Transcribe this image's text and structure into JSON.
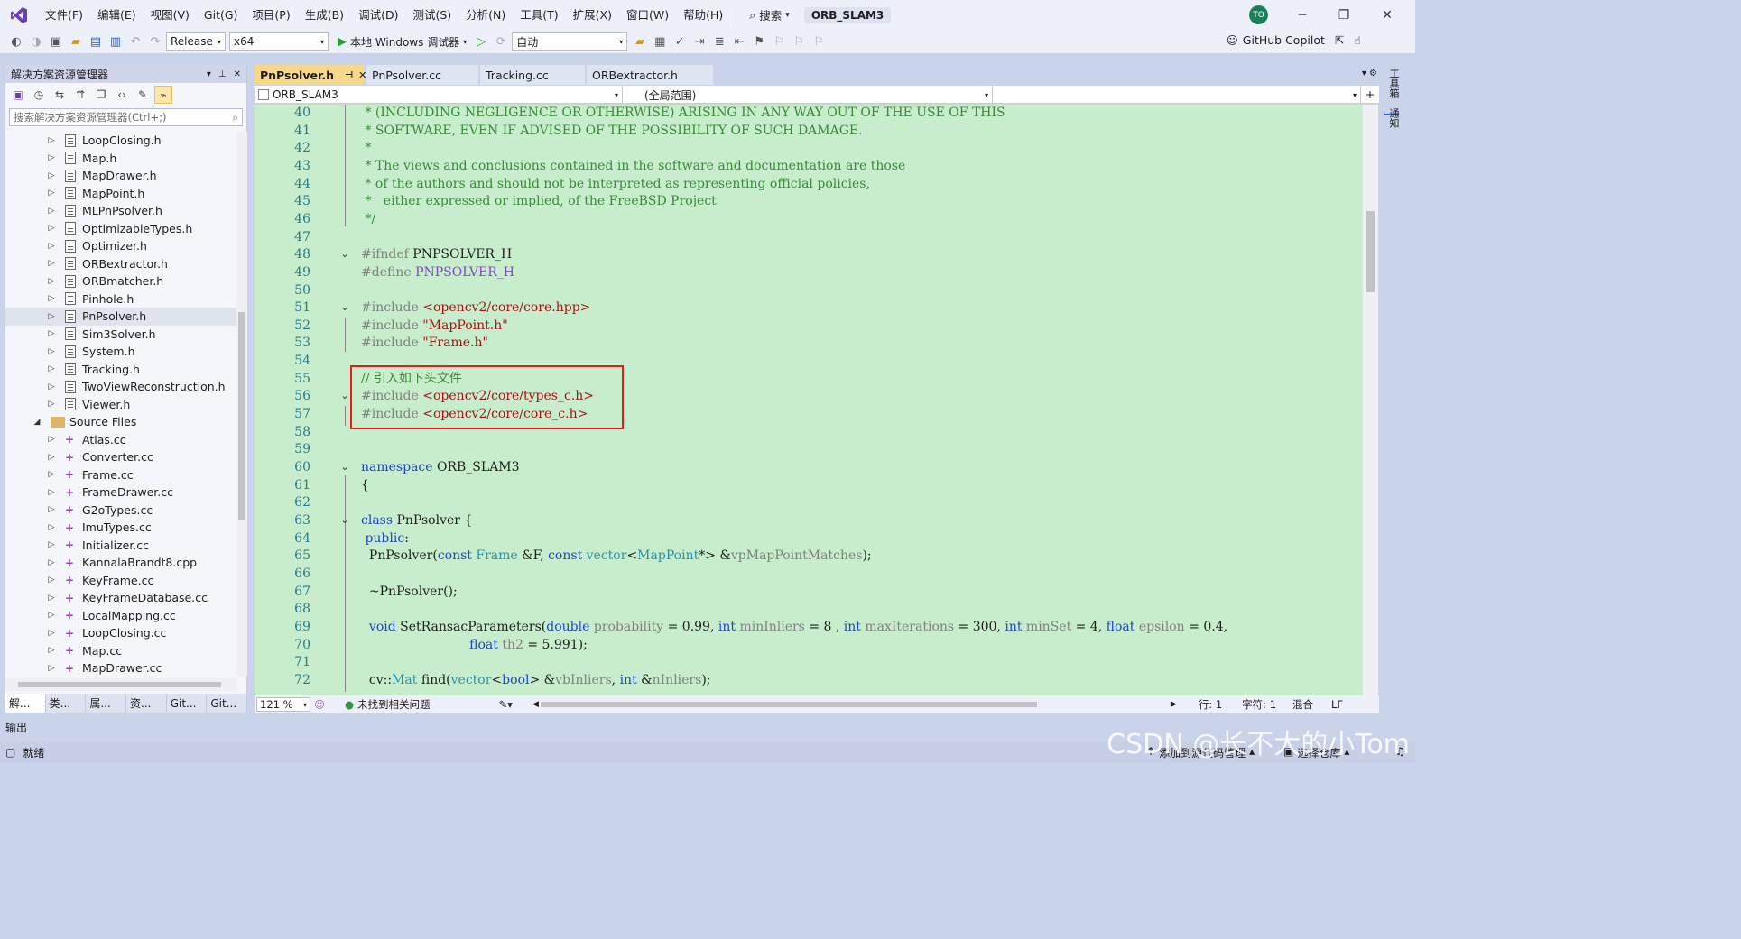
{
  "titlebar": {
    "menu": [
      "文件(F)",
      "编辑(E)",
      "视图(V)",
      "Git(G)",
      "项目(P)",
      "生成(B)",
      "调试(D)",
      "测试(S)",
      "分析(N)",
      "工具(T)",
      "扩展(X)",
      "窗口(W)",
      "帮助(H)"
    ],
    "search_label": "搜索",
    "solution_name": "ORB_SLAM3",
    "avatar_initials": "TO"
  },
  "toolbar": {
    "config": "Release",
    "platform": "x64",
    "debugger": "本地 Windows 调试器",
    "auto": "自动",
    "copilot": "GitHub Copilot"
  },
  "solution_explorer": {
    "title": "解决方案资源管理器",
    "search_placeholder": "搜索解决方案资源管理器(Ctrl+;)",
    "items": [
      {
        "name": "LoopClosing.h",
        "kind": "h",
        "selected": false
      },
      {
        "name": "Map.h",
        "kind": "h",
        "selected": false
      },
      {
        "name": "MapDrawer.h",
        "kind": "h",
        "selected": false
      },
      {
        "name": "MapPoint.h",
        "kind": "h",
        "selected": false
      },
      {
        "name": "MLPnPsolver.h",
        "kind": "h",
        "selected": false
      },
      {
        "name": "OptimizableTypes.h",
        "kind": "h",
        "selected": false
      },
      {
        "name": "Optimizer.h",
        "kind": "h",
        "selected": false
      },
      {
        "name": "ORBextractor.h",
        "kind": "h",
        "selected": false
      },
      {
        "name": "ORBmatcher.h",
        "kind": "h",
        "selected": false
      },
      {
        "name": "Pinhole.h",
        "kind": "h",
        "selected": false
      },
      {
        "name": "PnPsolver.h",
        "kind": "h",
        "selected": true
      },
      {
        "name": "Sim3Solver.h",
        "kind": "h",
        "selected": false
      },
      {
        "name": "System.h",
        "kind": "h",
        "selected": false
      },
      {
        "name": "Tracking.h",
        "kind": "h",
        "selected": false
      },
      {
        "name": "TwoViewReconstruction.h",
        "kind": "h",
        "selected": false
      },
      {
        "name": "Viewer.h",
        "kind": "h",
        "selected": false
      },
      {
        "name": "Source Files",
        "kind": "folder",
        "selected": false
      },
      {
        "name": "Atlas.cc",
        "kind": "cc",
        "selected": false
      },
      {
        "name": "Converter.cc",
        "kind": "cc",
        "selected": false
      },
      {
        "name": "Frame.cc",
        "kind": "cc",
        "selected": false
      },
      {
        "name": "FrameDrawer.cc",
        "kind": "cc",
        "selected": false
      },
      {
        "name": "G2oTypes.cc",
        "kind": "cc",
        "selected": false
      },
      {
        "name": "ImuTypes.cc",
        "kind": "cc",
        "selected": false
      },
      {
        "name": "Initializer.cc",
        "kind": "cc",
        "selected": false
      },
      {
        "name": "KannalaBrandt8.cpp",
        "kind": "cc",
        "selected": false
      },
      {
        "name": "KeyFrame.cc",
        "kind": "cc",
        "selected": false
      },
      {
        "name": "KeyFrameDatabase.cc",
        "kind": "cc",
        "selected": false
      },
      {
        "name": "LocalMapping.cc",
        "kind": "cc",
        "selected": false
      },
      {
        "name": "LoopClosing.cc",
        "kind": "cc",
        "selected": false
      },
      {
        "name": "Map.cc",
        "kind": "cc",
        "selected": false
      },
      {
        "name": "MapDrawer.cc",
        "kind": "cc",
        "selected": false
      }
    ],
    "bottom_tabs": [
      "解...",
      "类...",
      "属...",
      "资...",
      "Git...",
      "Git..."
    ]
  },
  "editor": {
    "tabs": [
      {
        "label": "PnPsolver.h",
        "active": true
      },
      {
        "label": "PnPsolver.cc",
        "active": false
      },
      {
        "label": "Tracking.cc",
        "active": false
      },
      {
        "label": "ORBextractor.h",
        "active": false
      }
    ],
    "nav_project": "ORB_SLAM3",
    "nav_scope": "(全局范围)",
    "zoom": "121 %",
    "issues": "未找到相关问题",
    "line": "行: 1",
    "col": "字符: 1",
    "mix": "混合",
    "eol": "LF",
    "lines": [
      {
        "n": "40",
        "t": " * (INCLUDING NEGLIGENCE OR OTHERWISE) ARISING IN ANY WAY OUT OF THE USE OF THIS"
      },
      {
        "n": "41",
        "t": " * SOFTWARE, EVEN IF ADVISED OF THE POSSIBILITY OF SUCH DAMAGE."
      },
      {
        "n": "42",
        "t": " *"
      },
      {
        "n": "43",
        "t": " * The views and conclusions contained in the software and documentation are those"
      },
      {
        "n": "44",
        "t": " * of the authors and should not be interpreted as representing official policies,"
      },
      {
        "n": "45",
        "t": " *   either expressed or implied, of the FreeBSD Project"
      },
      {
        "n": "46",
        "t": " */"
      },
      {
        "n": "47",
        "t": ""
      },
      {
        "n": "48",
        "t": "#ifndef PNPSOLVER_H"
      },
      {
        "n": "49",
        "t": "#define PNPSOLVER_H"
      },
      {
        "n": "50",
        "t": ""
      },
      {
        "n": "51",
        "t": "#include <opencv2/core/core.hpp>"
      },
      {
        "n": "52",
        "t": "#include \"MapPoint.h\""
      },
      {
        "n": "53",
        "t": "#include \"Frame.h\""
      },
      {
        "n": "54",
        "t": ""
      },
      {
        "n": "55",
        "t": "// 引入如下头文件"
      },
      {
        "n": "56",
        "t": "#include <opencv2/core/types_c.h>"
      },
      {
        "n": "57",
        "t": "#include <opencv2/core/core_c.h>"
      },
      {
        "n": "58",
        "t": ""
      },
      {
        "n": "59",
        "t": ""
      },
      {
        "n": "60",
        "t": "namespace ORB_SLAM3"
      },
      {
        "n": "61",
        "t": "{"
      },
      {
        "n": "62",
        "t": ""
      },
      {
        "n": "63",
        "t": "class PnPsolver {"
      },
      {
        "n": "64",
        "t": " public:"
      },
      {
        "n": "65",
        "t": "  PnPsolver(const Frame &F, const vector<MapPoint*> &vpMapPointMatches);"
      },
      {
        "n": "66",
        "t": ""
      },
      {
        "n": "67",
        "t": "  ~PnPsolver();"
      },
      {
        "n": "68",
        "t": ""
      },
      {
        "n": "69",
        "t": "  void SetRansacParameters(double probability = 0.99, int minInliers = 8 , int maxIterations = 300, int minSet = 4, float epsilon = 0.4,"
      },
      {
        "n": "70",
        "t": "                           float th2 = 5.991);"
      },
      {
        "n": "71",
        "t": ""
      },
      {
        "n": "72",
        "t": "  cv::Mat find(vector<bool> &vbInliers, int &nInliers);"
      }
    ]
  },
  "right_dock": [
    "工具箱",
    "通知"
  ],
  "output_label": "输出",
  "status": {
    "ready": "就绪",
    "add_source": "添加到源代码管理",
    "select_repo": "选择仓库"
  },
  "watermark": "CSDN @长不大的小Tom",
  "colors": {
    "editor_bg": "#c7edcc",
    "accent_tab": "#f5d88b",
    "highlight_box": "#e02020",
    "keyword": "#1f46c9",
    "comment": "#3a8a3a"
  }
}
